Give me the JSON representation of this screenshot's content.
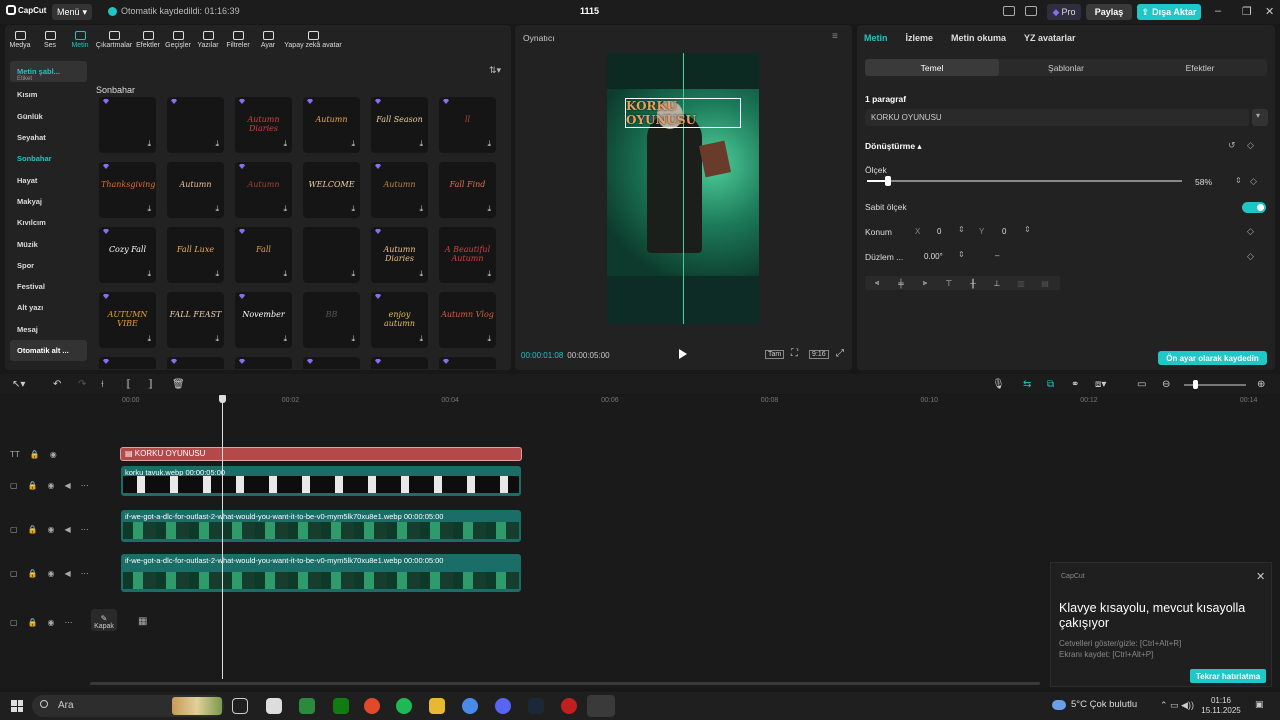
{
  "app": {
    "logo_text": "CapCut",
    "menu_label": "Menü",
    "autosave_text": "Otomatik kaydedildi: 01:16:39",
    "project_title": "1115",
    "pro_label": "Pro",
    "share_label": "Paylaş",
    "export_label": "Dışa Aktar"
  },
  "top_tabs": [
    "Medya",
    "Ses",
    "Metin",
    "Çıkartmalar",
    "Efektler",
    "Geçişler",
    "Yazılar",
    "Filtreler",
    "Ayar",
    "Yapay zekâ avatar"
  ],
  "active_tab": "Metin",
  "sidebar": {
    "selected": "Metin şabl...",
    "sub": "Etiket",
    "items": [
      "Kısım",
      "Günlük",
      "Seyahat",
      "Sonbahar",
      "Hayat",
      "Makyaj",
      "Kıvılcım",
      "Müzik",
      "Spor",
      "Festival",
      "Alt yazı",
      "Mesaj",
      "Otomatik alt ..."
    ],
    "active": "Sonbahar"
  },
  "section_title": "Sonbahar",
  "templates": [
    {
      "text": "",
      "color": "#e0a030"
    },
    {
      "text": "",
      "color": "#c03030"
    },
    {
      "text": "Autumn Diaries",
      "color": "#d04040"
    },
    {
      "text": "Autumn",
      "color": "#f0a050"
    },
    {
      "text": "Fall Season",
      "color": "#e8d0a0"
    },
    {
      "text": "ll",
      "color": "#c04040"
    },
    {
      "text": "Thanksgiving",
      "color": "#e07030"
    },
    {
      "text": "Autumn",
      "color": "#e8c0a0"
    },
    {
      "text": "Autumn",
      "color": "#a04030"
    },
    {
      "text": "WELCOME",
      "color": "#f0d0a0"
    },
    {
      "text": "Autumn",
      "color": "#c08040"
    },
    {
      "text": "Fall Find",
      "color": "#e07050"
    },
    {
      "text": "Cozy Fall",
      "color": "#ffffff"
    },
    {
      "text": "Fall Luxe",
      "color": "#f0b060"
    },
    {
      "text": "Fall",
      "color": "#e0a040"
    },
    {
      "text": "",
      "color": "#a03020"
    },
    {
      "text": "Autumn Diaries",
      "color": "#f0c080"
    },
    {
      "text": "A Beautiful Autumn",
      "color": "#d04040"
    },
    {
      "text": "AUTUMN VIBE",
      "color": "#e8a030"
    },
    {
      "text": "FALL FEAST",
      "color": "#f0d0b0"
    },
    {
      "text": "November",
      "color": "#ffffff"
    },
    {
      "text": "BB",
      "color": "#555555"
    },
    {
      "text": "enjoy autumn",
      "color": "#e0c050"
    },
    {
      "text": "Autumn Vlog",
      "color": "#d06040"
    }
  ],
  "player": {
    "title": "Oynatıcı",
    "overlay_text": "KORKU OYUNUSU",
    "current_time": "00:00:01:08",
    "total_time": "00:00:05:00",
    "full_label": "Tam",
    "ratio_label": "9:16"
  },
  "props": {
    "tabs": [
      "Metin",
      "İzleme",
      "Metin okuma",
      "YZ avatarlar"
    ],
    "active_tab": "Metin",
    "subtabs": [
      "Temel",
      "Şablonlar",
      "Efektler"
    ],
    "paragraph_label": "1 paragraf",
    "text_value": "KORKU OYUNUSU",
    "transform_label": "Dönüştürme",
    "scale_label": "Ölçek",
    "scale_value": "58%",
    "scale_fraction": 0.58,
    "uniform_label": "Sabit ölçek",
    "position_label": "Konum",
    "x_label": "X",
    "x_value": "0",
    "y_label": "Y",
    "y_value": "0",
    "rotate_label": "Düzlem ...",
    "rotate_value": "0.00°",
    "preset_label": "Ön ayar olarak kaydedin"
  },
  "ruler": [
    "00:00",
    "00:02",
    "00:04",
    "00:06",
    "00:08",
    "00:10",
    "00:12",
    "00:14"
  ],
  "tracks": {
    "text_clip": "KORKU OYUNUSU",
    "clip1": "korku tavuk.webp   00:00:05:00",
    "clip2": "if-we-got-a-dlc-for-outlast-2-what-would-you-want-it-to-be-v0-mym5lk70xu8e1.webp   00:00:05:00",
    "clip3": "if-we-got-a-dlc-for-outlast-2-what-would-you-want-it-to-be-v0-mym5lk70xu8e1.webp   00:00:05:00",
    "cover_label": "Kapak"
  },
  "notification": {
    "app": "CapCut",
    "title": "Klavye kısayolu, mevcut kısayolla çakışıyor",
    "line1": "Cetvelleri göster/gizle: [Ctrl+Alt+R]",
    "line2": "Ekranı kaydet: [Ctrl+Alt+P]",
    "button": "Tekrar hatırlatma"
  },
  "taskbar": {
    "search_placeholder": "Ara",
    "weather": "5°C  Çok bulutlu",
    "time": "01:16",
    "date": "15.11.2025"
  },
  "colors": {
    "accent": "#1ec7c8",
    "text_clip": "#b4494a",
    "video_clip": "#1b6e68"
  }
}
